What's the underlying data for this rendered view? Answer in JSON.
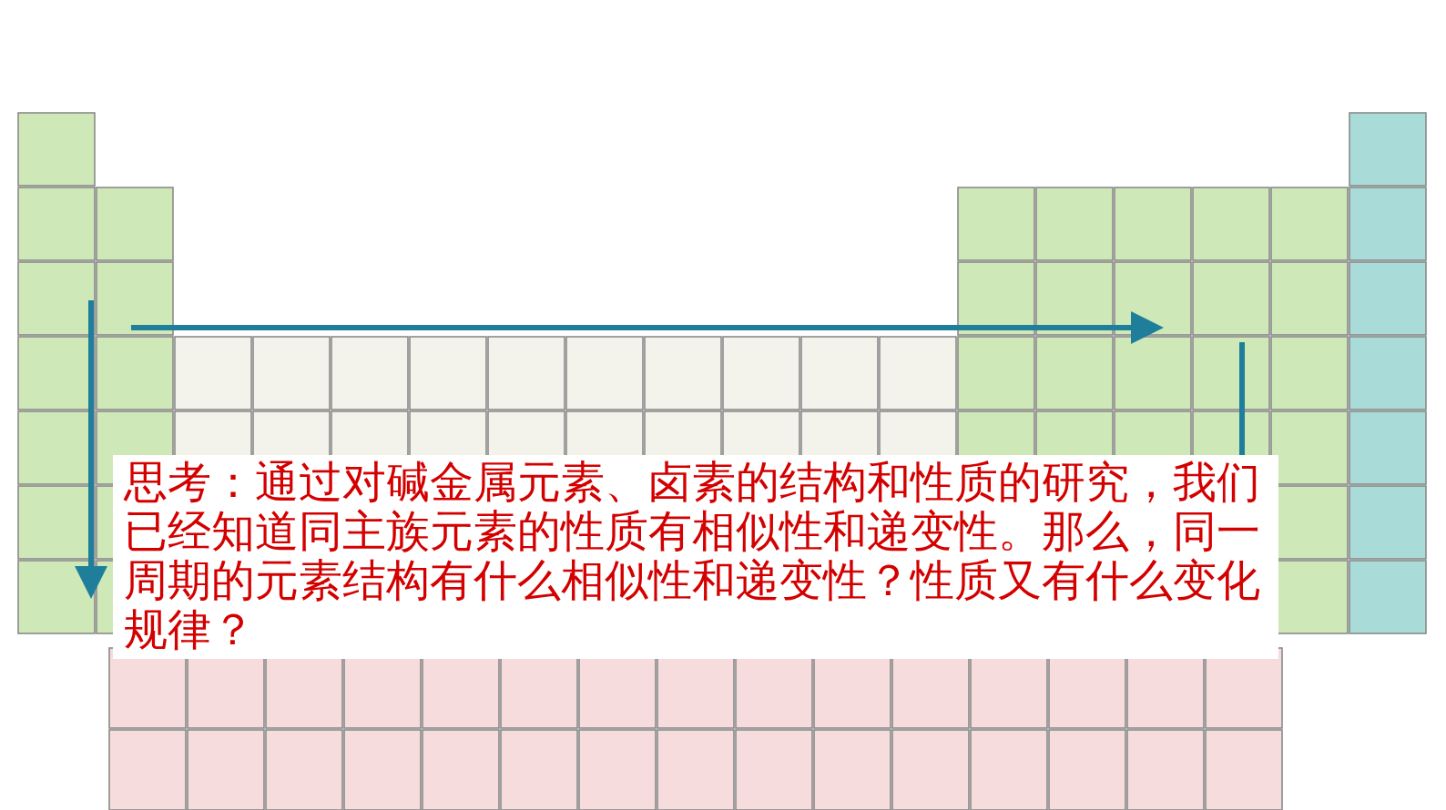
{
  "question": {
    "text": "思考：通过对碱金属元素、卤素的结构和性质的研究，我们已经知道同主族元素的性质有相似性和递变性。那么，同一周期的元素结构有什么相似性和递变性？性质又有什么变化规律？"
  }
}
